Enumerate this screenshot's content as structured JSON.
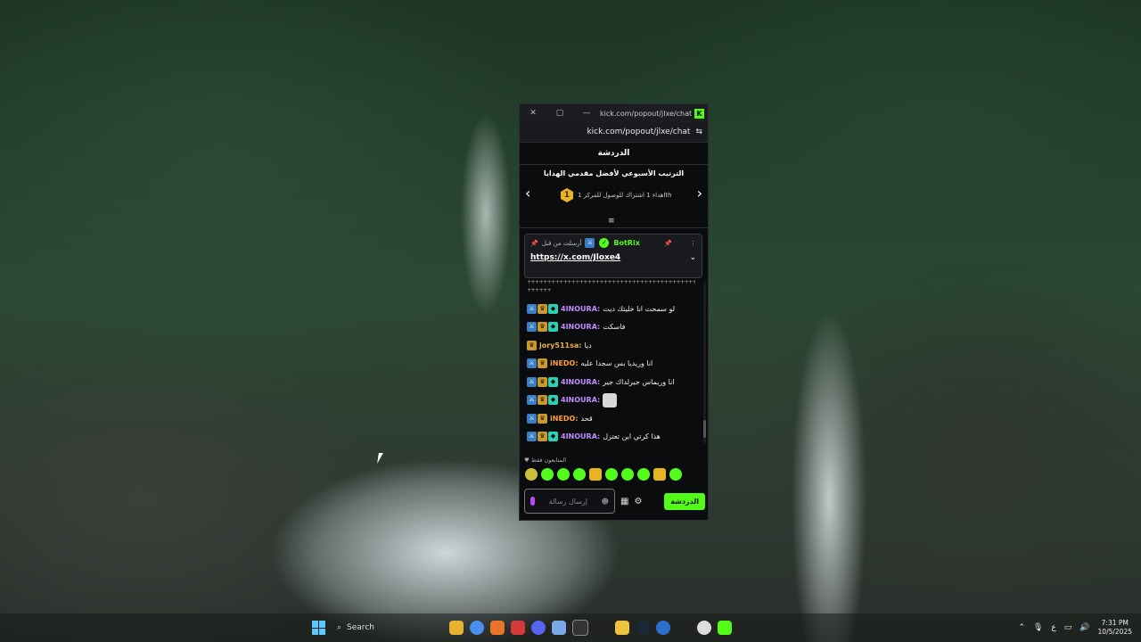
{
  "window": {
    "title_url": "kick.com/popout/jlxe/chat ...",
    "address_url": "kick.com/popout/jlxe/chat",
    "close": "✕",
    "maximize": "▢",
    "minimize": "—"
  },
  "chat": {
    "header_title": "الدردشة",
    "leaderboard": {
      "title": "الترتيب الأسبوعي لأفضل مقدمي الهدايا",
      "rank_number": "1",
      "rank_text": "اهداء 1 اشتراك للوصول للمركز 1th"
    },
    "pinned": {
      "sender": "BotRix",
      "sent_by": "أرسلت من قبل",
      "link": "https://x.com/Jloxe4"
    },
    "separator": "++++++++++++++++++++++++++++++++++++++++++++++++++++++",
    "separator2": "++++++",
    "messages": [
      {
        "user": "4INOURA:",
        "text": "لو سمحت انا خليتك ديت",
        "color": "purple"
      },
      {
        "user": "4INOURA:",
        "text": "فاسكت",
        "color": "purple"
      },
      {
        "user": "jory511sa:",
        "text": "ديا",
        "color": "gold"
      },
      {
        "user": "iNEDO:",
        "text": "انا وريديا بس سجدا عليه",
        "color": "orange"
      },
      {
        "user": "4INOURA:",
        "text": "انا وريماس جيرلداك جير",
        "color": "purple"
      },
      {
        "user": "4INOURA:",
        "text": "",
        "color": "purple"
      },
      {
        "user": "iNEDO:",
        "text": "قحد",
        "color": "orange"
      },
      {
        "user": "4INOURA:",
        "text": "هذا كرتي اين تعتزل",
        "color": "purple"
      }
    ],
    "viewers_label": "المتابعون فقط",
    "input_placeholder": "إرسال رسالة",
    "send_label": "الدردشة"
  },
  "taskbar": {
    "search_placeholder": "Search",
    "time": "7:31 PM",
    "date": "10/5/2025",
    "lang": "ع"
  },
  "colors": {
    "kick_green": "#53fc18",
    "user_purple": "#c08cff",
    "user_gold": "#e6b34b",
    "user_orange": "#ff9b42"
  }
}
